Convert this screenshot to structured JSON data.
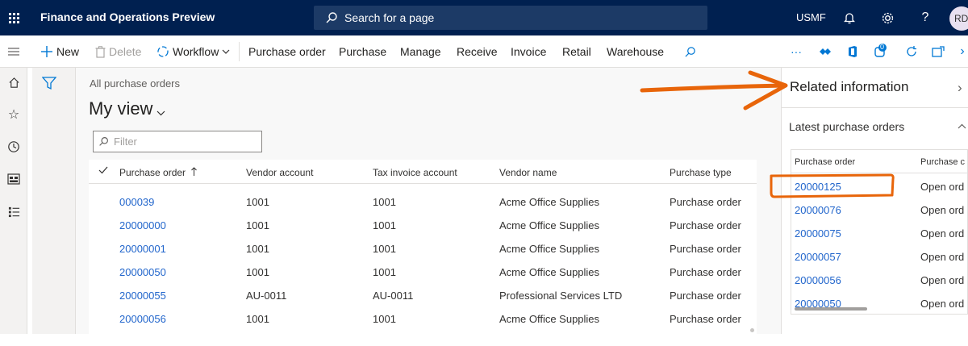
{
  "header": {
    "app_title": "Finance and Operations Preview",
    "search_placeholder": "Search for a page",
    "company": "USMF",
    "avatar_initials": "RD"
  },
  "actions": {
    "new": "New",
    "delete": "Delete",
    "workflow": "Workflow",
    "tabs": [
      "Purchase order",
      "Purchase",
      "Manage",
      "Receive",
      "Invoice",
      "Retail",
      "Warehouse"
    ],
    "more": "···",
    "badge_count": "0"
  },
  "main": {
    "breadcrumb": "All purchase orders",
    "view_title": "My view",
    "filter_placeholder": "Filter",
    "columns": [
      "Purchase order",
      "Vendor account",
      "Tax invoice account",
      "Vendor name",
      "Purchase type"
    ],
    "rows": [
      [
        "000039",
        "1001",
        "1001",
        "Acme Office Supplies",
        "Purchase order"
      ],
      [
        "20000000",
        "1001",
        "1001",
        "Acme Office Supplies",
        "Purchase order"
      ],
      [
        "20000001",
        "1001",
        "1001",
        "Acme Office Supplies",
        "Purchase order"
      ],
      [
        "20000050",
        "1001",
        "1001",
        "Acme Office Supplies",
        "Purchase order"
      ],
      [
        "20000055",
        "AU-0011",
        "AU-0011",
        "Professional Services LTD",
        "Purchase order"
      ],
      [
        "20000056",
        "1001",
        "1001",
        "Acme Office Supplies",
        "Purchase order"
      ]
    ]
  },
  "related": {
    "title": "Related information",
    "section_title": "Latest purchase orders",
    "columns": [
      "Purchase order",
      "Purchase c"
    ],
    "rows": [
      [
        "20000125",
        "Open ord"
      ],
      [
        "20000076",
        "Open ord"
      ],
      [
        "20000075",
        "Open ord"
      ],
      [
        "20000057",
        "Open ord"
      ],
      [
        "20000056",
        "Open ord"
      ],
      [
        "20000050",
        "Open ord"
      ]
    ]
  },
  "colors": {
    "nav_bg": "#002050",
    "link": "#2266cc",
    "annotation": "#e8650a"
  },
  "icons": [
    "waffle-icon",
    "search-icon",
    "bell-icon",
    "gear-icon",
    "help-icon",
    "hamburger-icon",
    "home-icon",
    "star-icon",
    "clock-icon",
    "workspace-icon",
    "list-icon",
    "filter-funnel-icon"
  ]
}
